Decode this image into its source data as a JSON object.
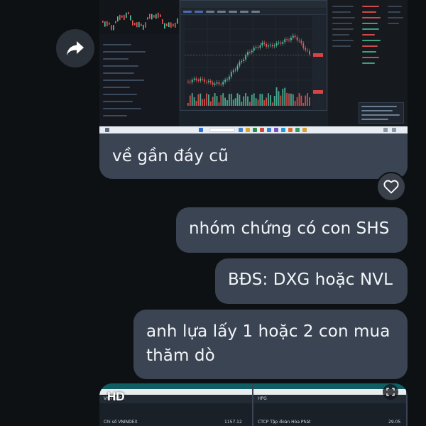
{
  "theme": {
    "background": "#0e1114",
    "bubble": "#3b4453",
    "text": "#f3f6f9",
    "candle_up": "#4fc3a1",
    "candle_down": "#ef5350"
  },
  "messages": {
    "screenshot_caption": "về gần đáy cũ",
    "msg1": "nhóm chứng có con SHS",
    "msg2": "BĐS: DXG hoặc NVL",
    "msg3_line1": "anh lựa lấy 1 hoặc 2 con mua",
    "msg3_line2": "thăm dò"
  },
  "icons": {
    "share": "share-forward-icon",
    "like": "heart-outline-icon",
    "expand": "expand-icon"
  },
  "media": {
    "badge": "HD",
    "left_title": "VN-INDEX",
    "left_row_label": "Chỉ số VNINDEX",
    "left_row_value": "1157.12",
    "right_title": "HPG",
    "right_row_label": "CTCP Tập đoàn Hòa Phát",
    "right_row_value": "29.05"
  }
}
